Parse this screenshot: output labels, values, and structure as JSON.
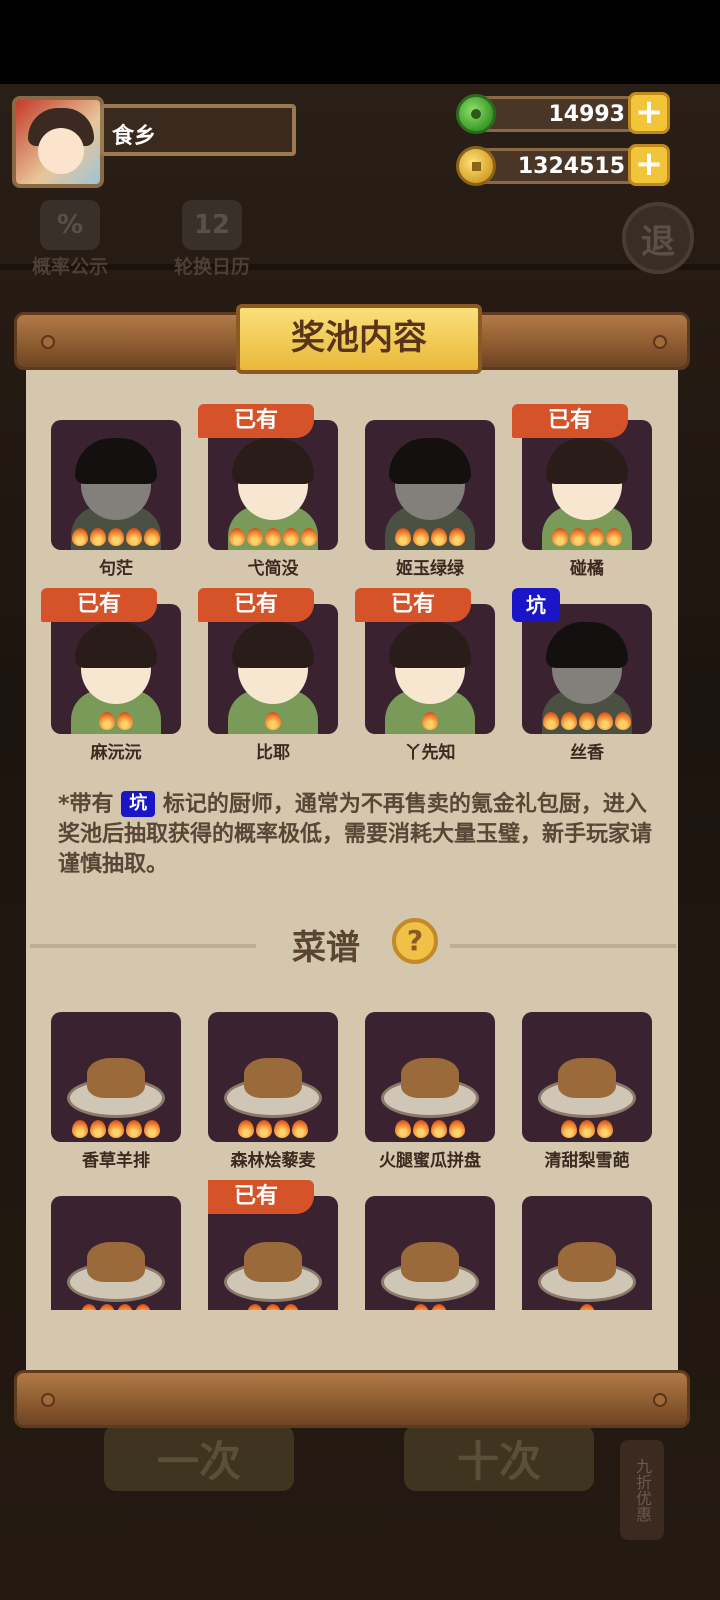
{
  "player": {
    "name": "食乡"
  },
  "resources": {
    "jade": "14993",
    "coins": "1324515"
  },
  "background": {
    "probability_label": "概率公示",
    "probability_icon": "%",
    "calendar_label": "轮换日历",
    "calendar_icon": "12",
    "round_button": "退",
    "single_draw": "一次",
    "ten_draw": "十次",
    "discount_tag": "九折优惠"
  },
  "panel": {
    "title": "奖池内容",
    "owned_badge": "已有",
    "pit_badge": "坑",
    "chefs": [
      {
        "name": "句茫",
        "stars": 5,
        "owned": false,
        "pit": false
      },
      {
        "name": "弋简没",
        "stars": 5,
        "owned": true,
        "pit": false
      },
      {
        "name": "姬玉绿绿",
        "stars": 4,
        "owned": false,
        "pit": false
      },
      {
        "name": "碰橘",
        "stars": 4,
        "owned": true,
        "pit": false
      },
      {
        "name": "麻沅沅",
        "stars": 2,
        "owned": true,
        "pit": false
      },
      {
        "name": "比耶",
        "stars": 1,
        "owned": true,
        "pit": false
      },
      {
        "name": "丫先知",
        "stars": 1,
        "owned": true,
        "pit": false
      },
      {
        "name": "丝香",
        "stars": 5,
        "owned": false,
        "pit": true
      }
    ],
    "note_prefix": "*带有",
    "note_body": "标记的厨师，通常为不再售卖的氪金礼包厨，进入奖池后抽取获得的概率极低，需要消耗大量玉璧，新手玩家请谨慎抽取。",
    "recipes_title": "菜谱",
    "help_icon": "?",
    "recipes": [
      {
        "name": "香草羊排",
        "stars": 5,
        "owned": false
      },
      {
        "name": "森林烩藜麦",
        "stars": 4,
        "owned": false
      },
      {
        "name": "火腿蜜瓜拼盘",
        "stars": 4,
        "owned": false
      },
      {
        "name": "清甜梨雪葩",
        "stars": 3,
        "owned": false
      },
      {
        "name": "",
        "stars": 4,
        "owned": false
      },
      {
        "name": "",
        "stars": 3,
        "owned": true
      },
      {
        "name": "",
        "stars": 2,
        "owned": false
      },
      {
        "name": "",
        "stars": 1,
        "owned": false
      }
    ]
  },
  "colors": {
    "owned_badge": "#d6532a",
    "pit_badge": "#1a16c8",
    "parchment": "#d5c7ad",
    "card": "#3a2230"
  }
}
